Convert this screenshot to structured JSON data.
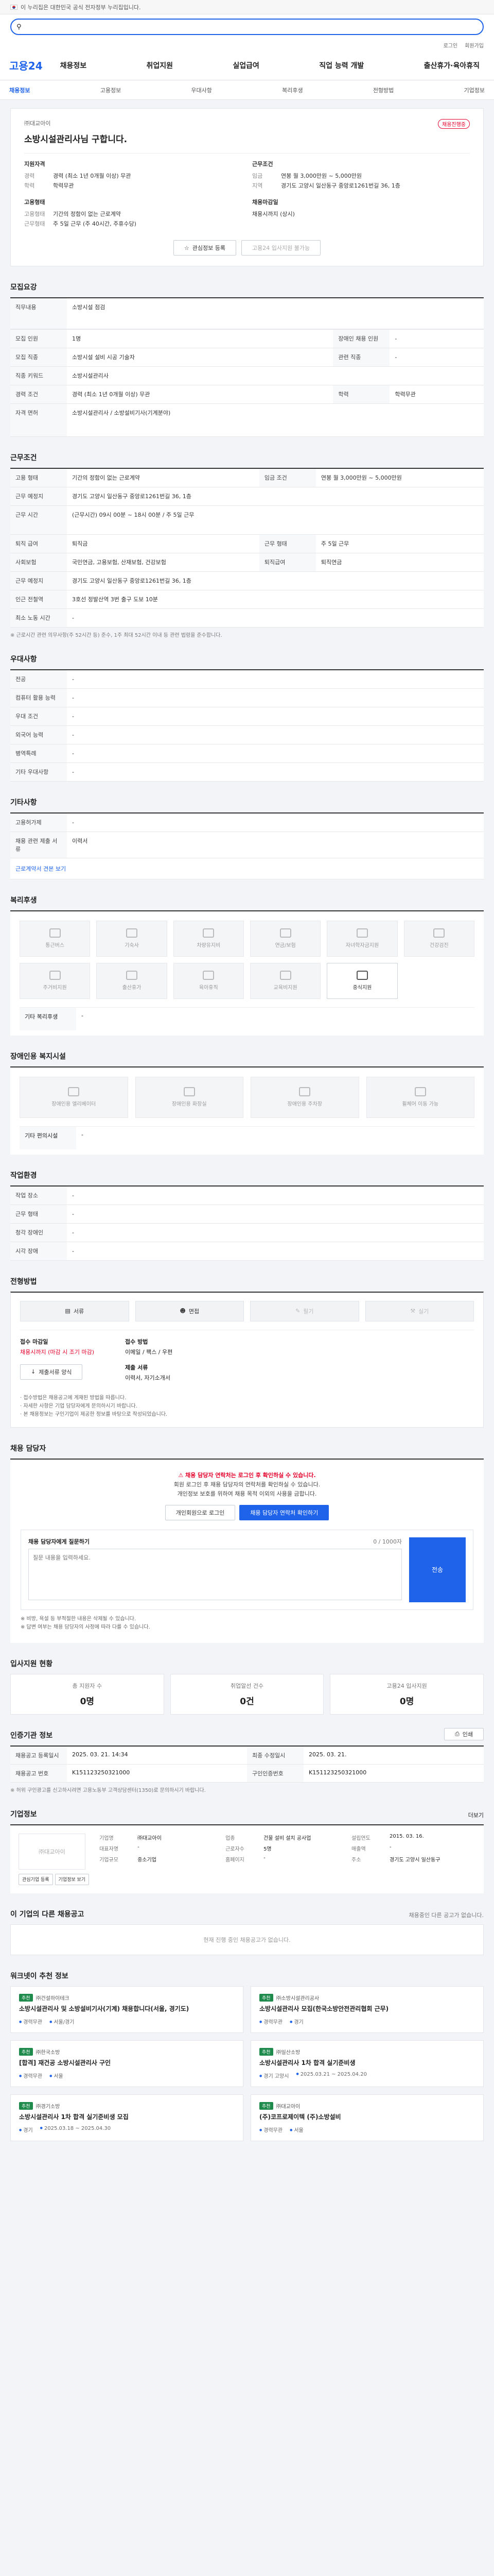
{
  "gov_bar": {
    "text": "이 누리집은 대한민국 공식 전자정부 누리집입니다."
  },
  "brand": {
    "search_placeholder": ""
  },
  "top_links": [
    "로그인",
    "회원가입"
  ],
  "gnb": {
    "logo": "고용24",
    "menu": [
      "채용정보",
      "취업지원",
      "실업급여",
      "직업 능력 개발",
      "출산휴가·육아휴직"
    ]
  },
  "subnav": {
    "items": [
      "채용정보",
      "고용정보",
      "우대사항",
      "복리후생",
      "전형방법",
      "기업정보"
    ],
    "active": 0
  },
  "headline": {
    "company": "㈜대교아이",
    "status_badge": "채용진행중",
    "title": "소방시설관리사님 구합니다.",
    "qualifications_title": "지원자격",
    "career_label": "경력",
    "career_value": "경력 (최소 1년 0개월 이상) 무관",
    "education_label": "학력",
    "education_value": "학력무관",
    "conditions_title": "근무조건",
    "wage_label": "임금",
    "wage_value": "연봉 월 3,000만원 ~ 5,000만원",
    "location_label": "지역",
    "location_value": "경기도 고양시 일산동구 중앙로1261번길 36, 1층",
    "employment_title": "고용형태",
    "emp_type_label": "고용형태",
    "emp_type_value": "기간의 정함이 없는 근로계약",
    "work_type_label": "근무형태",
    "work_type_value": "주 5일 근무 (주 40시간, 주휴수당)",
    "deadline_title": "채용마감일",
    "deadline_value": "채용시까지 (상시)",
    "btn_interest": "관심정보 등록",
    "btn_apply": "고용24 입사지원 불가능"
  },
  "recruit": {
    "title": "모집요강",
    "rows": [
      {
        "k": "직무내용",
        "v": "소방시설 점검"
      }
    ],
    "detail": [
      {
        "k": "모집 인원",
        "v": "1명",
        "k2": "장애인 채용 인원",
        "v2": "-"
      },
      {
        "k": "모집 직종",
        "v": "소방시설 설비 시공 기술자",
        "k2": "관련 직종",
        "v2": "-"
      },
      {
        "k": "직종 키워드",
        "v": "소방시설관리사",
        "k2": "",
        "v2": ""
      },
      {
        "k": "경력 조건",
        "v": "경력 (최소 1년 0개월 이상) 무관",
        "k2": "학력",
        "v2": "학력무관"
      },
      {
        "k": "자격 면허",
        "v": "소방시설관리사 / 소방설비기사(기계분야)",
        "k2": "",
        "v2": ""
      }
    ]
  },
  "conditions": {
    "title": "근무조건",
    "rows": [
      {
        "k": "고용 형태",
        "v": "기간의 정함이 없는 근로계약",
        "k2": "임금 조건",
        "v2": "연봉 월 3,000만원 ~ 5,000만원"
      },
      {
        "k": "근무 예정지",
        "v": "경기도 고양시 일산동구 중앙로1261번길 36, 1층",
        "k2": "",
        "v2": ""
      },
      {
        "k": "근무 시간",
        "v": "(근무시간) 09시 00분 ~ 18시 00분 / 주 5일 근무",
        "k2": "",
        "v2": ""
      },
      {
        "k": "퇴직 급여",
        "v": "퇴직금",
        "k2": "근무 형태",
        "v2": "주 5일 근무"
      },
      {
        "k": "사회보험",
        "v": "국민연금, 고용보험, 산재보험, 건강보험",
        "k2": "퇴직급여",
        "v2": "퇴직연금"
      },
      {
        "k": "근무 예정지",
        "v": "경기도 고양시 일산동구 중앙로1261번길 36, 1층",
        "k2": "",
        "v2": ""
      },
      {
        "k": "인근 전철역",
        "v": "3호선 정발산역 3번 출구 도보 10분",
        "k2": "",
        "v2": ""
      },
      {
        "k": "최소 노동 시간",
        "v": "-",
        "k2": "",
        "v2": ""
      }
    ],
    "note": "※ 근로시간 관련 의무사항(주 52시간 등) 준수, 1주 최대 52시간 이내 등 관련 법령을 준수합니다."
  },
  "preference": {
    "title": "우대사항",
    "rows": [
      {
        "k": "전공",
        "v": "-"
      },
      {
        "k": "컴퓨터 활용 능력",
        "v": "-"
      },
      {
        "k": "우대 조건",
        "v": "-"
      },
      {
        "k": "외국어 능력",
        "v": "-"
      },
      {
        "k": "병역특례",
        "v": "-"
      },
      {
        "k": "기타 우대사항",
        "v": "-"
      }
    ]
  },
  "other": {
    "title": "기타사항",
    "rows": [
      {
        "k": "고용허가제",
        "v": "-"
      },
      {
        "k": "채용 관련 제출 서류",
        "v": "이력서"
      }
    ],
    "link": "근로계약서 견본 보기"
  },
  "welfare": {
    "title": "복리후생",
    "items": [
      {
        "label": "통근버스",
        "on": false
      },
      {
        "label": "기숙사",
        "on": false
      },
      {
        "label": "차량유지비",
        "on": false
      },
      {
        "label": "연금/보험",
        "on": false
      },
      {
        "label": "자녀학자금지원",
        "on": false
      },
      {
        "label": "건강검진",
        "on": false
      },
      {
        "label": "주거비지원",
        "on": false
      },
      {
        "label": "출산휴가",
        "on": false
      },
      {
        "label": "육아휴직",
        "on": false
      },
      {
        "label": "교육비지원",
        "on": false
      },
      {
        "label": "중식지원",
        "on": true
      }
    ],
    "etc_label": "기타 복리후생",
    "etc_value": "-"
  },
  "disability": {
    "title": "장애인용 복지시설",
    "items": [
      "장애인용 엘리베이터",
      "장애인용 화장실",
      "장애인용 주차장",
      "휠체어 이동 가능"
    ],
    "etc_label": "기타 편의시설",
    "etc_value": "-"
  },
  "worksite": {
    "title": "작업환경",
    "rows": [
      {
        "k": "작업 장소",
        "v": "-",
        "k2": "",
        "v2": ""
      },
      {
        "k": "근무 형태",
        "v": "-",
        "k2": "",
        "v2": ""
      },
      {
        "k": "청각 장애인",
        "v": "-",
        "k2": "",
        "v2": ""
      },
      {
        "k": "시각 장애",
        "v": "-",
        "k2": "",
        "v2": ""
      }
    ]
  },
  "apply": {
    "title": "전형방법",
    "methods": [
      {
        "label": "서류",
        "on": true
      },
      {
        "label": "면접",
        "on": true
      },
      {
        "label": "필기",
        "on": false
      },
      {
        "label": "실기",
        "on": false
      }
    ],
    "period_label": "접수 마감일",
    "period_value": "채용시까지 (마감 시 조기 마감)",
    "method_label": "접수 방법",
    "method_value": "이메일 / 팩스 / 우편",
    "docs_label": "제출 서류",
    "docs_value": "이력서, 자기소개서",
    "btn_docs": "제출서류 양식",
    "bullets": [
      "· 접수방법은 채용공고에 게재된 방법을 따릅니다.",
      "· 자세한 사항은 기업 담당자에게 문의하시기 바랍니다.",
      "· 본 채용정보는 구인기업이 제공한 정보를 바탕으로 작성되었습니다."
    ]
  },
  "contact": {
    "title": "채용 담당자",
    "warn": "채용 담당자 연락처는 로그인 후 확인하실 수 있습니다.",
    "line1": "회원 로그인 후 채용 담당자의 연락처를 확인하실 수 있습니다.",
    "line2": "개인정보 보호를 위하여 채용 목적 이외의 사용을 금합니다.",
    "btn_login": "개인회원으로 로그인",
    "btn_view": "채용 담당자 연락처 확인하기",
    "qa_title": "채용 담당자에게 질문하기",
    "qa_placeholder": "질문 내용을 입력하세요.",
    "qa_send": "전송",
    "qa_counter": "0 / 1000자",
    "footnotes": [
      "※ 비방, 욕설 등 부적절한 내용은 삭제될 수 있습니다.",
      "※ 답변 여부는 채용 담당자의 사정에 따라 다를 수 있습니다."
    ]
  },
  "status": {
    "title": "입사지원 현황",
    "items": [
      {
        "label": "총 지원자 수",
        "value": "0명"
      },
      {
        "label": "취업알선 건수",
        "value": "0건"
      },
      {
        "label": "고용24 입사지원",
        "value": "0명"
      }
    ]
  },
  "posting_info": {
    "title": "인증기관 정보",
    "rows": [
      [
        "채용공고 등록일시",
        "2025. 03. 21. 14:34",
        "최종 수정일시",
        "2025. 03. 21."
      ],
      [
        "채용공고 번호",
        "K151123250321000",
        "구인인증번호",
        "K151123250321000"
      ]
    ],
    "btn": "인쇄",
    "note": "※ 허위 구인광고를 신고하시려면 고용노동부 고객상담센터(1350)로 문의하시기 바랍니다."
  },
  "company": {
    "title": "기업정보",
    "more": "더보기",
    "logo_alt": "㈜대교아이",
    "fields": [
      [
        "기업명",
        "㈜대교아이"
      ],
      [
        "업종",
        "건물 설비 설치 공사업"
      ],
      [
        "설립연도",
        "2015. 03. 16."
      ],
      [
        "대표자명",
        "-"
      ],
      [
        "근로자수",
        "5명"
      ],
      [
        "매출액",
        "-"
      ],
      [
        "기업규모",
        "중소기업"
      ],
      [
        "홈페이지",
        "-"
      ],
      [
        "주소",
        "경기도 고양시 일산동구"
      ]
    ],
    "btn1": "관심기업 등록",
    "btn2": "기업정보 보기"
  },
  "more_jobs": {
    "title": "이 기업의 다른 채용공고",
    "note": "채용중인 다른 공고가 없습니다.",
    "empty": "현재 진행 중인 채용공고가 없습니다."
  },
  "recommend": {
    "title": "워크넷이 추천 정보",
    "items": [
      {
        "tag": "추천",
        "company": "㈜건설하이테크",
        "title": "소방시설관리사 및 소방설비기사(기계) 채용합니다(서울, 경기도)",
        "meta": [
          "경력무관",
          "서울/경기"
        ]
      },
      {
        "tag": "추천",
        "company": "㈜소방시설관리공사",
        "title": "소방시설관리사 모집(한국소방안전관리협회 근무)",
        "meta": [
          "경력무관",
          "경기"
        ]
      },
      {
        "tag": "추천",
        "company": "㈜한국소방",
        "title": "[합격] 재건공 소방시설관리사 구인",
        "meta": [
          "경력무관",
          "서울"
        ]
      },
      {
        "tag": "추천",
        "company": "㈜일산소방",
        "title": "소방시설관리사 1차 합격 실기준비생",
        "meta": [
          "경기 고양시",
          "2025.03.21 ~ 2025.04.20"
        ]
      },
      {
        "tag": "추천",
        "company": "㈜경기소방",
        "title": "소방시설관리사 1차 합격 실기준비생 모집",
        "meta": [
          "경기",
          "2025.03.18 ~ 2025.04.30"
        ]
      },
      {
        "tag": "추천",
        "company": "㈜대교아이",
        "title": "(주)코프로제이텍 (주)소방설비",
        "meta": [
          "경력무관",
          "서울"
        ]
      }
    ]
  }
}
